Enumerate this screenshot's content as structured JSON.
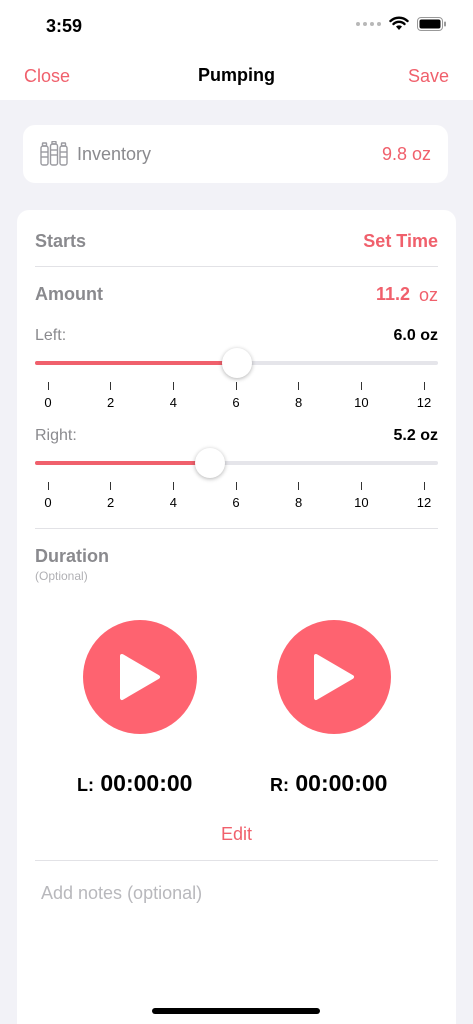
{
  "status_bar": {
    "time": "3:59"
  },
  "nav": {
    "close": "Close",
    "title": "Pumping",
    "save": "Save"
  },
  "inventory": {
    "label": "Inventory",
    "value": "9.8 oz"
  },
  "starts": {
    "label": "Starts",
    "action": "Set Time"
  },
  "amount": {
    "label": "Amount",
    "value": "11.2",
    "unit": "oz"
  },
  "left": {
    "label": "Left:",
    "value": "6.0 oz",
    "level": 6.0,
    "max": 12
  },
  "right": {
    "label": "Right:",
    "value": "5.2 oz",
    "level": 5.2,
    "max": 12
  },
  "ticks": [
    "0",
    "2",
    "4",
    "6",
    "8",
    "10",
    "12"
  ],
  "duration": {
    "label": "Duration",
    "optional": "(Optional)",
    "left_prefix": "L:",
    "left_time": "00:00:00",
    "right_prefix": "R:",
    "right_time": "00:00:00",
    "edit": "Edit"
  },
  "notes": {
    "placeholder": "Add notes (optional)"
  },
  "colors": {
    "accent": "#f0606c",
    "play": "#fe6370"
  }
}
